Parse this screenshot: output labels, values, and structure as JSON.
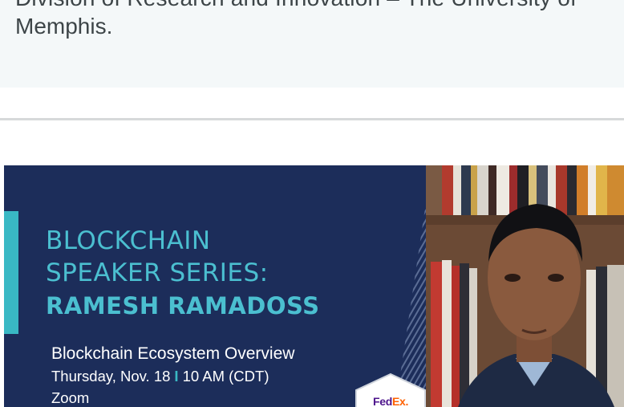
{
  "top_card": {
    "line1": "Division of Research and Innovation – The University of",
    "line2": "Memphis."
  },
  "banner": {
    "title_line1": "BLOCKCHAIN",
    "title_line2": "SPEAKER SERIES:",
    "speaker": "RAMESH RAMADOSS",
    "talk_title": "Blockchain Ecosystem Overview",
    "date": "Thursday, Nov. 18",
    "separator": "I",
    "time": "10 AM (CDT)",
    "location": "Zoom",
    "logo": {
      "fe": "Fed",
      "ex": "Ex."
    },
    "colors": {
      "background": "#1c2d5a",
      "accent": "#39b8c4",
      "title": "#4bbfd0"
    }
  }
}
